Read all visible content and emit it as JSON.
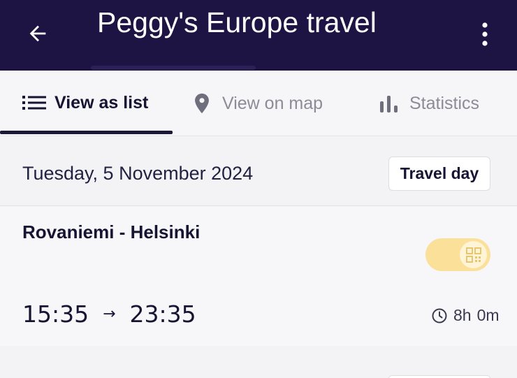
{
  "appbar": {
    "title": "Peggy's Europe travel",
    "back_icon": "arrow-left-icon",
    "menu_icon": "more-vert-icon"
  },
  "tabs": [
    {
      "label": "View as list",
      "icon": "list-icon",
      "active": true
    },
    {
      "label": "View on map",
      "icon": "map-pin-icon",
      "active": false
    },
    {
      "label": "Statistics",
      "icon": "bar-chart-icon",
      "active": false
    }
  ],
  "day": {
    "date": "Tuesday, 5 November 2024",
    "badge": "Travel day"
  },
  "trip": {
    "route": "Rovaniemi - Helsinki",
    "depart": "15:35",
    "arrow": "→",
    "arrive": "23:35",
    "duration_hours": "8h",
    "duration_minutes": "0m",
    "ticket_icon": "qr-code-icon",
    "clock_icon": "clock-icon"
  },
  "colors": {
    "appbar": "#1e1444",
    "toggle": "#fbe09a",
    "text": "#161432",
    "inactive": "#8c8b98"
  }
}
